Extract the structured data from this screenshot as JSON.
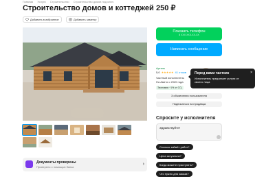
{
  "breadcrumb": [
    "Главная",
    "Услуги",
    "Строительство",
    "Строительство домов под ключ"
  ],
  "title": "Строительство домов и коттеджей",
  "price": "250 ₽",
  "actions": {
    "favorite": "Добавить в избранное",
    "note": "Добавить заметку"
  },
  "contact": {
    "phone_label": "Показать телефон",
    "phone_masked": "8 ХХХ ХХХ-ХХ-ХХ",
    "message_label": "Написать сообщение"
  },
  "seller": {
    "type": "Артель",
    "rating": "5,0",
    "stars": "★★★★★",
    "reviews": "41 отзыв",
    "line1": "Частный исполнитель",
    "since": "На Авито с 2020 года",
    "eco": "Экономия ~1% от CO₂",
    "btn_more": "3 объявления пользователя",
    "btn_subscribe": "Подписаться на продавца"
  },
  "tooltip": {
    "title": "Перед вами частник",
    "text": "Исполнитель предлагает услуги от своего лица",
    "close": "×"
  },
  "ask": {
    "title": "Спросите у исполнителя",
    "input_value": "Здравствуйте!",
    "questions": [
      "Сколько займёт работ?",
      "Цена актуальна?",
      "Когда можете приступить?",
      "Что нужно для заказа?"
    ]
  },
  "documents": {
    "title": "Документы проверены",
    "subtitle": "Проверено с помощью банка",
    "arrow": "›"
  },
  "colors": {
    "green": "#02d15c",
    "blue": "#00aaff",
    "dark": "#1f1f1f"
  },
  "icons": {
    "favorite": "heart-icon",
    "note": "note-icon"
  }
}
